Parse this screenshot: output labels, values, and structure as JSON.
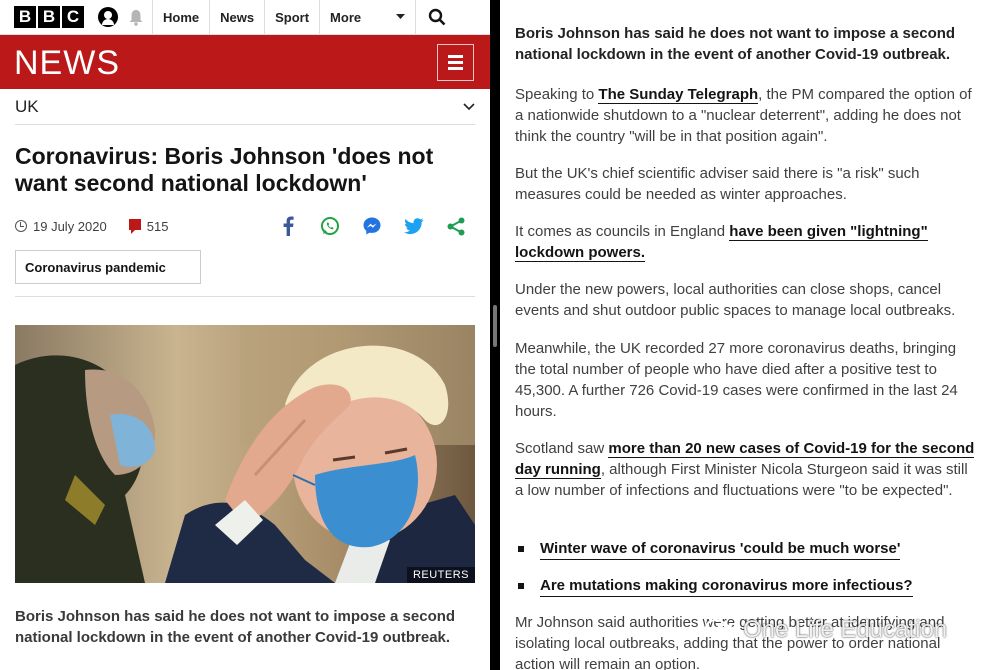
{
  "header": {
    "bbc_letters": [
      "B",
      "B",
      "C"
    ],
    "nav": [
      {
        "label": "Home"
      },
      {
        "label": "News"
      },
      {
        "label": "Sport"
      },
      {
        "label": "More"
      }
    ],
    "icons": [
      "account-icon",
      "notifications-bell-icon",
      "search-icon",
      "chevron-down-icon"
    ]
  },
  "news_bar": {
    "logo_text": "NEWS",
    "background": "#bb1919",
    "menu_icon": "hamburger-menu-icon"
  },
  "section": {
    "label": "UK",
    "icon": "chevron-down-icon"
  },
  "article": {
    "headline": "Coronavirus: Boris Johnson 'does not want second national lockdown'",
    "date": "19 July 2020",
    "comments_count": "515",
    "share_icons": [
      "facebook-icon",
      "whatsapp-icon",
      "messenger-icon",
      "twitter-icon",
      "share-icon"
    ],
    "topic_tag": "Coronavirus pandemic",
    "photo_credit": "REUTERS",
    "intro": "Boris Johnson has said he does not want to impose a second national lockdown in the event of another Covid-19 outbreak."
  },
  "right": {
    "intro": "Boris Johnson has said he does not want to impose a second national lockdown in the event of another Covid-19 outbreak.",
    "p1": {
      "before": "Speaking to ",
      "link": "The Sunday Telegraph",
      "after": ", the PM compared the option of a nationwide shutdown to a \"nuclear deterrent\", adding he does not think the country \"will be in that position again\"."
    },
    "p2": "But the UK's chief scientific adviser said there is \"a risk\" such measures could be needed as winter approaches.",
    "p3": {
      "before": "It comes as councils in England ",
      "link": "have been given \"lightning\" lockdown powers."
    },
    "p4": "Under the new powers, local authorities can close shops, cancel events and shut outdoor public spaces to manage local outbreaks.",
    "p5": "Meanwhile, the UK recorded 27 more coronavirus deaths, bringing the total number of people who have died after a positive test to 45,300. A further 726 Covid-19 cases were confirmed in the last 24 hours.",
    "p6": {
      "before": "Scotland saw ",
      "link": "more than 20 new cases of Covid-19 for the second day running",
      "after": ", although First Minister Nicola Sturgeon said it was still a low number of infections and fluctuations were \"to be expected\"."
    },
    "bullets": [
      {
        "label": "Winter wave of coronavirus 'could be much worse'"
      },
      {
        "label": "Are mutations making coronavirus more infectious?"
      }
    ],
    "p7": "Mr Johnson said authorities were getting better at identifying and isolating local outbreaks, adding that the power to order national action will remain an option.",
    "watermark": "One Life Education"
  }
}
